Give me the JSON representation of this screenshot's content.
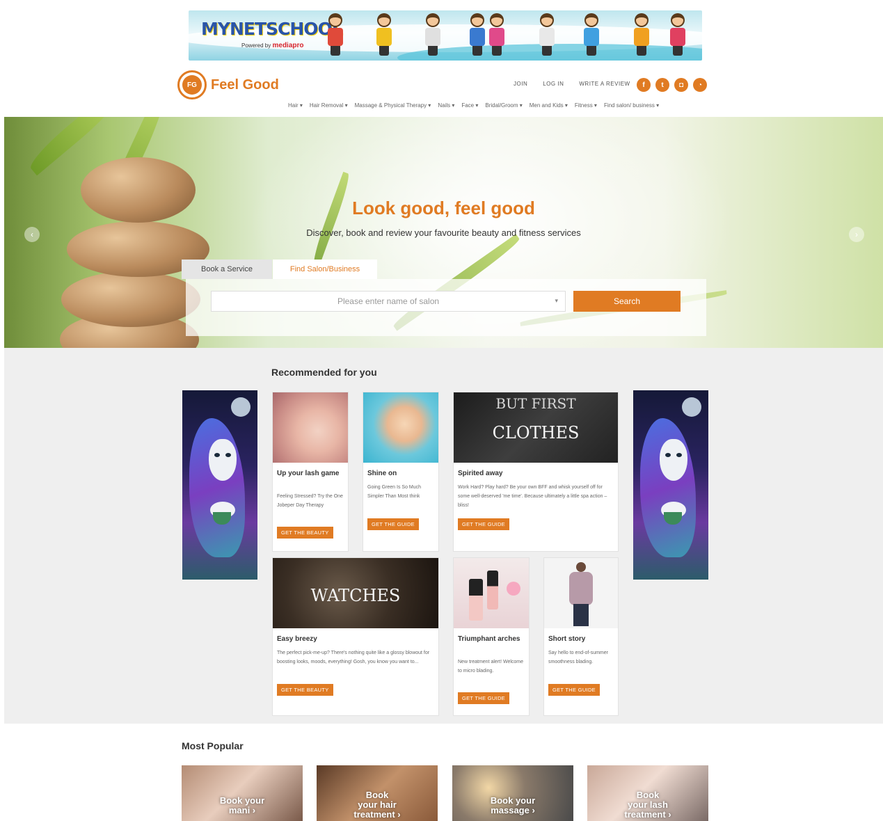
{
  "banner": {
    "logo_text": "MYNETSCHOOL",
    "powered_prefix": "Powered by",
    "powered_brand": "mediapro"
  },
  "brand": {
    "mark": "FG",
    "name": "Feel Good"
  },
  "toplinks": [
    "JOIN",
    "LOG IN",
    "WRITE A REVIEW"
  ],
  "social": [
    {
      "icon": "facebook-icon",
      "glyph": "f"
    },
    {
      "icon": "twitter-icon",
      "glyph": "t"
    },
    {
      "icon": "instagram-icon",
      "glyph": "◘"
    },
    {
      "icon": "rss-icon",
      "glyph": "◔"
    }
  ],
  "nav": [
    "Hair ▾",
    "Hair Removal ▾",
    "Massage & Physical Therapy ▾",
    "Nails ▾",
    "Face ▾",
    "Bridal/Groom ▾",
    "Men and Kids ▾",
    "Fitness ▾",
    "Find salon/ business ▾"
  ],
  "hero": {
    "title": "Look good, feel good",
    "subtitle": "Discover, book and review your favourite beauty and fitness services",
    "tab_book": "Book a Service",
    "tab_find": "Find Salon/Business",
    "search_placeholder": "Please enter name of salon",
    "search_button": "Search",
    "prev": "‹",
    "next": "›"
  },
  "recommended": {
    "heading": "Recommended for you",
    "cards": [
      {
        "title": "Up your lash game",
        "desc": "Feeling Stressed? Try the One Jobeper Day Therapy",
        "cta": "GET THE BEAUTY"
      },
      {
        "title": "Shine on",
        "desc": "Going Green Is So Much Simpler Than Most think",
        "cta": "GET THE GUIDE"
      },
      {
        "title": "Spirited away",
        "desc": "Work Hard? Play hard? Be your own BFF and whisk yourself off for some well-deserved 'me time'. Because ultimately a little spa action – bliss!",
        "cta": "GET THE GUIDE",
        "overlay_small": "BUT FIRST",
        "overlay_big": "CLOTHES"
      },
      {
        "title": "Easy breezy",
        "desc": "The perfect pick-me-up? There's nothing quite like a glossy blowout for boosting looks, moods, everything! Gosh, you know you want to...",
        "cta": "GET THE BEAUTY",
        "overlay_big": "WATCHES"
      },
      {
        "title": "Triumphant arches",
        "desc": "New treatment alert! Welcome to micro blading.",
        "cta": "GET THE GUIDE"
      },
      {
        "title": "Short story",
        "desc": "Say hello to end-of-summer smoothness blading.",
        "cta": "GET THE GUIDE"
      }
    ]
  },
  "popular": {
    "heading": "Most Popular",
    "tiles": [
      {
        "line1": "Book your",
        "line2": "mani ›"
      },
      {
        "line1": "Book",
        "line2": "your hair",
        "line3": "treatment ›"
      },
      {
        "line1": "Book your",
        "line2": "massage ›"
      },
      {
        "line1": "Book",
        "line2": "your lash",
        "line3": "treatment ›"
      }
    ]
  },
  "colors": {
    "accent": "#e07b23"
  }
}
